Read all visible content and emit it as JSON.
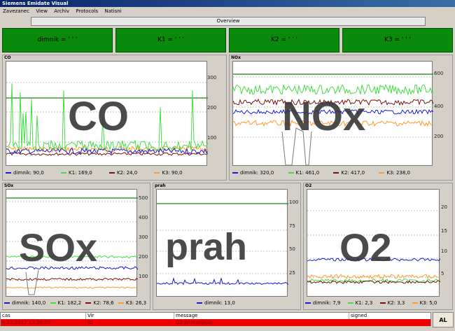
{
  "window": {
    "title": "Siemens Emidate Visual"
  },
  "menu": [
    "Zavezanec",
    "View",
    "Archiv",
    "Protocols",
    "Natisni"
  ],
  "overview_label": "Overview",
  "tiles": [
    "dimnik = ' ' '",
    "K1 = ' ' '",
    "K2 = ' ' '",
    "K3 = ' ' '"
  ],
  "colors": {
    "dimnik": "#1a1acc",
    "K1": "#44dd44",
    "K2": "#7a1010",
    "K3": "#ff9a30",
    "limit": "#118811",
    "tile": "#0a8a0a",
    "alarm": "#ee0000"
  },
  "panels": {
    "co": {
      "title": "CO",
      "big": "CO",
      "ticks": [
        "300",
        "200",
        "100"
      ],
      "legend": [
        {
          "series": "dimnik",
          "text": "dimnik: 90,0"
        },
        {
          "series": "K1",
          "text": "K1: 169,0"
        },
        {
          "series": "K2",
          "text": "K2: 24,0"
        },
        {
          "series": "K3",
          "text": "K3: 90,0"
        }
      ]
    },
    "nox": {
      "title": "NOx",
      "big": "NOx",
      "ticks": [
        "600",
        "400",
        "200"
      ],
      "legend": [
        {
          "series": "dimnik",
          "text": "dimnik: 320,0"
        },
        {
          "series": "K1",
          "text": "K1: 461,0"
        },
        {
          "series": "K2",
          "text": "K2: 417,0"
        },
        {
          "series": "K3",
          "text": "K3: 238,0"
        }
      ]
    },
    "sox": {
      "title": "SOx",
      "big": "SOx",
      "ticks": [
        "500",
        "400",
        "300",
        "200",
        "100"
      ],
      "legend": [
        {
          "series": "dimnik",
          "text": "dimnik: 140,0"
        },
        {
          "series": "K1",
          "text": "K1: 182,2"
        },
        {
          "series": "K2",
          "text": "K2: 78,6"
        },
        {
          "series": "K3",
          "text": "K3: 26,3"
        }
      ]
    },
    "prah": {
      "title": "prah",
      "big": "prah",
      "ticks": [
        "100",
        "75",
        "50",
        "25"
      ],
      "legend": [
        {
          "series": "dimnik",
          "text": "dimnik: 13,0"
        }
      ]
    },
    "o2": {
      "title": "O2",
      "big": "O2",
      "ticks": [
        "20",
        "15",
        "10",
        "5"
      ],
      "legend": [
        {
          "series": "dimnik",
          "text": "dimnik: 7,9"
        },
        {
          "series": "K1",
          "text": "K1: 2,3"
        },
        {
          "series": "K2",
          "text": "K2: 3,3"
        },
        {
          "series": "K3",
          "text": "K3: 5,0"
        }
      ]
    }
  },
  "alarm": {
    "headers": [
      "cas",
      "Vir",
      "message",
      "signed"
    ],
    "row": [
      "9.12.2017 13:36:03",
      "IO",
      "O2 primanjkuje",
      ""
    ],
    "button": "AL"
  }
}
